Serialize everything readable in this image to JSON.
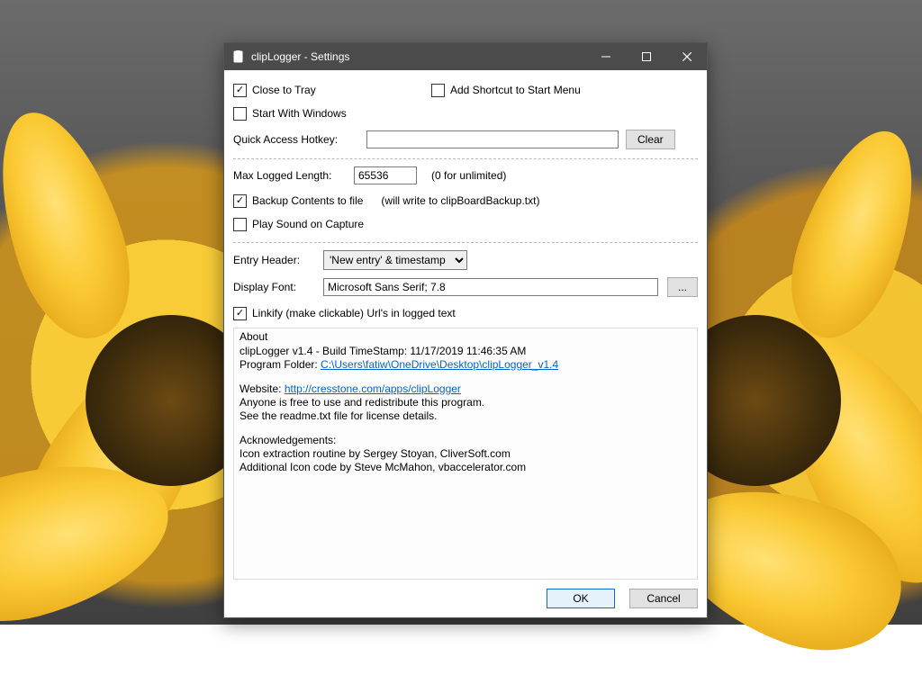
{
  "window": {
    "title": "clipLogger - Settings"
  },
  "options": {
    "close_to_tray": {
      "label": "Close to Tray",
      "checked": true
    },
    "add_shortcut": {
      "label": "Add Shortcut to Start Menu",
      "checked": false
    },
    "start_with_windows": {
      "label": "Start With Windows",
      "checked": false
    },
    "quick_access_label": "Quick Access Hotkey:",
    "quick_access_value": "",
    "clear_label": "Clear"
  },
  "logging": {
    "max_len_label": "Max Logged Length:",
    "max_len_value": "65536",
    "max_len_hint": "(0 for unlimited)",
    "backup": {
      "label": "Backup Contents to file",
      "checked": true,
      "hint": "(will write to clipBoardBackup.txt)"
    },
    "sound": {
      "label": "Play Sound on Capture",
      "checked": false
    }
  },
  "entry": {
    "header_label": "Entry Header:",
    "header_value": "'New entry' & timestamp",
    "font_label": "Display Font:",
    "font_value": "Microsoft Sans Serif; 7.8",
    "font_btn": "...",
    "linkify": {
      "label": "Linkify (make clickable) Url's in logged text",
      "checked": true
    }
  },
  "about": {
    "legend": "About",
    "line1a": "clipLogger v1.4   -   Build TimeStamp: 11/17/2019 11:46:35 AM",
    "folder_label": "Program Folder: ",
    "folder_link": "C:\\Users\\fatiw\\OneDrive\\Desktop\\clipLogger_v1.4",
    "website_label": "Website: ",
    "website_link": "http://cresstone.com/apps/clipLogger",
    "redistribute": "Anyone is free to use and redistribute this program.",
    "readme": "See the readme.txt file for license details.",
    "ack_title": "Acknowledgements:",
    "ack1": "Icon extraction routine by Sergey Stoyan, CliverSoft.com",
    "ack2": "Additional Icon code by Steve McMahon, vbaccelerator.com"
  },
  "footer": {
    "ok": "OK",
    "cancel": "Cancel"
  }
}
